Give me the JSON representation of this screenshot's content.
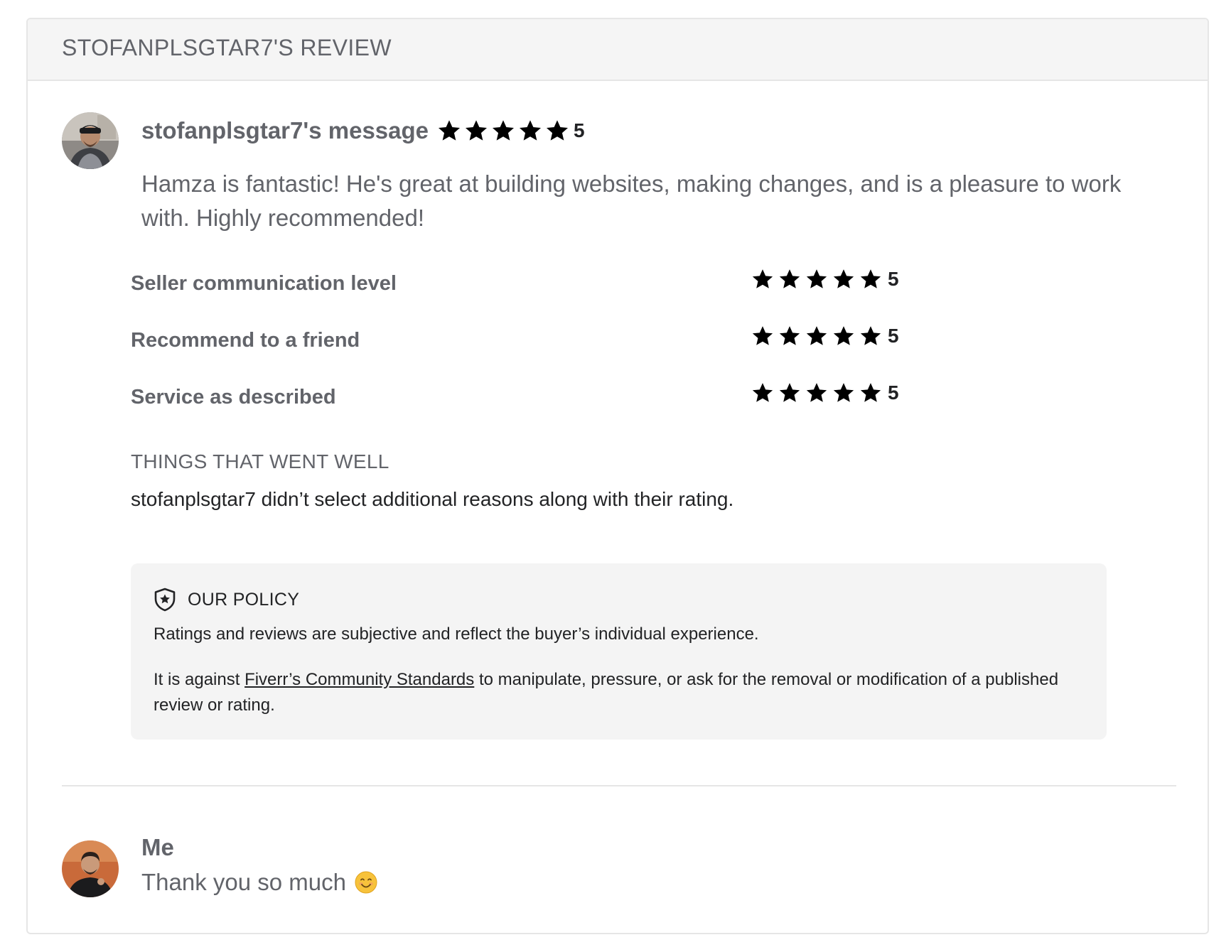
{
  "review": {
    "title": "STOFANPLSGTAR7'S REVIEW"
  },
  "message": {
    "author": "stofanplsgtar7's message",
    "rating": "5",
    "text": "Hamza is fantastic! He's great at building websites, making changes, and is a pleasure to work with. Highly recommended!"
  },
  "ratings": [
    {
      "label": "Seller communication level",
      "score": "5"
    },
    {
      "label": "Recommend to a friend",
      "score": "5"
    },
    {
      "label": "Service as described",
      "score": "5"
    }
  ],
  "things_went_well": {
    "label": "THINGS THAT WENT WELL",
    "text": "stofanplsgtar7 didn’t select additional reasons along with their rating."
  },
  "policy": {
    "title": "OUR POLICY",
    "paragraph1": "Ratings and reviews are subjective and reflect the buyer’s individual experience.",
    "paragraph2_before": "It is against ",
    "paragraph2_link": "Fiverr’s Community Standards",
    "paragraph2_after": " to manipulate, pressure, or ask for the removal or modification of a published review or rating."
  },
  "reply": {
    "author": "Me",
    "text": "Thank you so much"
  },
  "colors": {
    "text_gray": "#62646a",
    "text_dark": "#222325",
    "star": "#222325",
    "header_bg": "#f5f5f5",
    "policy_bg": "#f4f4f4",
    "border": "#e6e6e6"
  },
  "icons": {
    "star": "star-icon",
    "policy": "shield-star-icon",
    "emoji": "smiling-face-emoji"
  }
}
